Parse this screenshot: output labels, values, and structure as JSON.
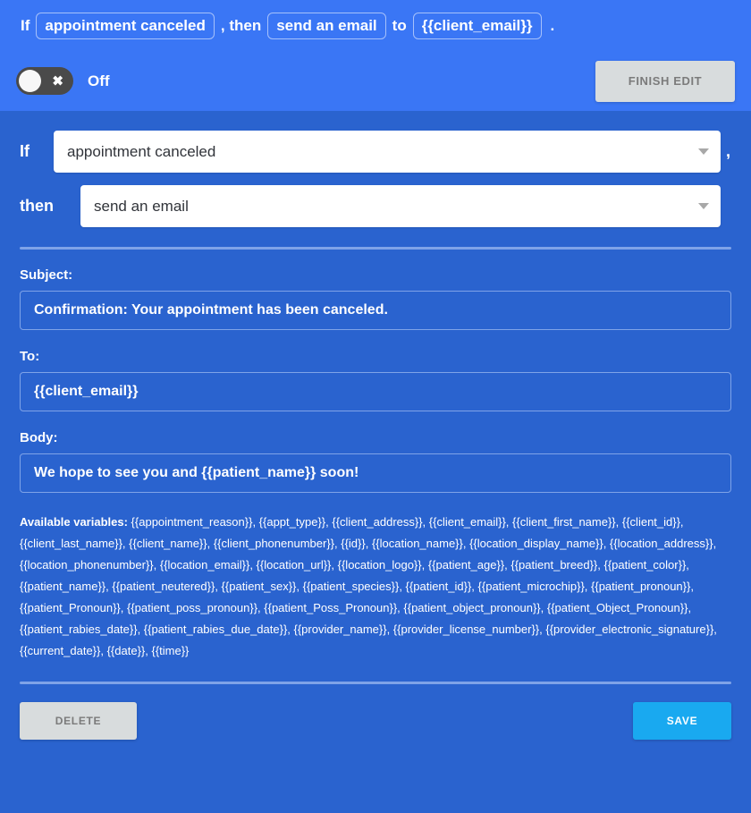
{
  "summary": {
    "word_if": "If",
    "trigger_chip": "appointment canceled",
    "word_then": ", then",
    "action_chip": "send an email",
    "word_to": "to",
    "recipient_chip": "{{client_email}}",
    "period": "."
  },
  "status": {
    "toggle_state_label": "Off",
    "toggle_icon": "x-icon",
    "finish_edit_label": "FINISH EDIT"
  },
  "rule": {
    "if_label": "If",
    "then_label": "then",
    "comma": ",",
    "trigger_value": "appointment canceled",
    "action_value": "send an email"
  },
  "email": {
    "subject_label": "Subject:",
    "subject_value": "Confirmation: Your appointment has been canceled.",
    "to_label": "To:",
    "to_value": "{{client_email}}",
    "body_label": "Body:",
    "body_value": "We hope to see you and {{patient_name}} soon!"
  },
  "variables": {
    "title": "Available variables:",
    "list": "{{appointment_reason}}, {{appt_type}}, {{client_address}}, {{client_email}}, {{client_first_name}}, {{client_id}}, {{client_last_name}}, {{client_name}}, {{client_phonenumber}}, {{id}}, {{location_name}}, {{location_display_name}}, {{location_address}}, {{location_phonenumber}}, {{location_email}}, {{location_url}}, {{location_logo}}, {{patient_age}}, {{patient_breed}}, {{patient_color}}, {{patient_name}}, {{patient_neutered}}, {{patient_sex}}, {{patient_species}}, {{patient_id}}, {{patient_microchip}}, {{patient_pronoun}}, {{patient_Pronoun}}, {{patient_poss_pronoun}}, {{patient_Poss_Pronoun}}, {{patient_object_pronoun}}, {{patient_Object_Pronoun}}, {{patient_rabies_date}}, {{patient_rabies_due_date}}, {{provider_name}}, {{provider_license_number}}, {{provider_electronic_signature}}, {{current_date}}, {{date}}, {{time}}"
  },
  "footer": {
    "delete_label": "DELETE",
    "save_label": "SAVE"
  },
  "colors": {
    "header_blue": "#3a76f5",
    "body_blue": "#2a63cf",
    "save_blue": "#19a9f0",
    "button_grey": "#d8dcdd",
    "divider_blue": "#7fa3e8"
  }
}
